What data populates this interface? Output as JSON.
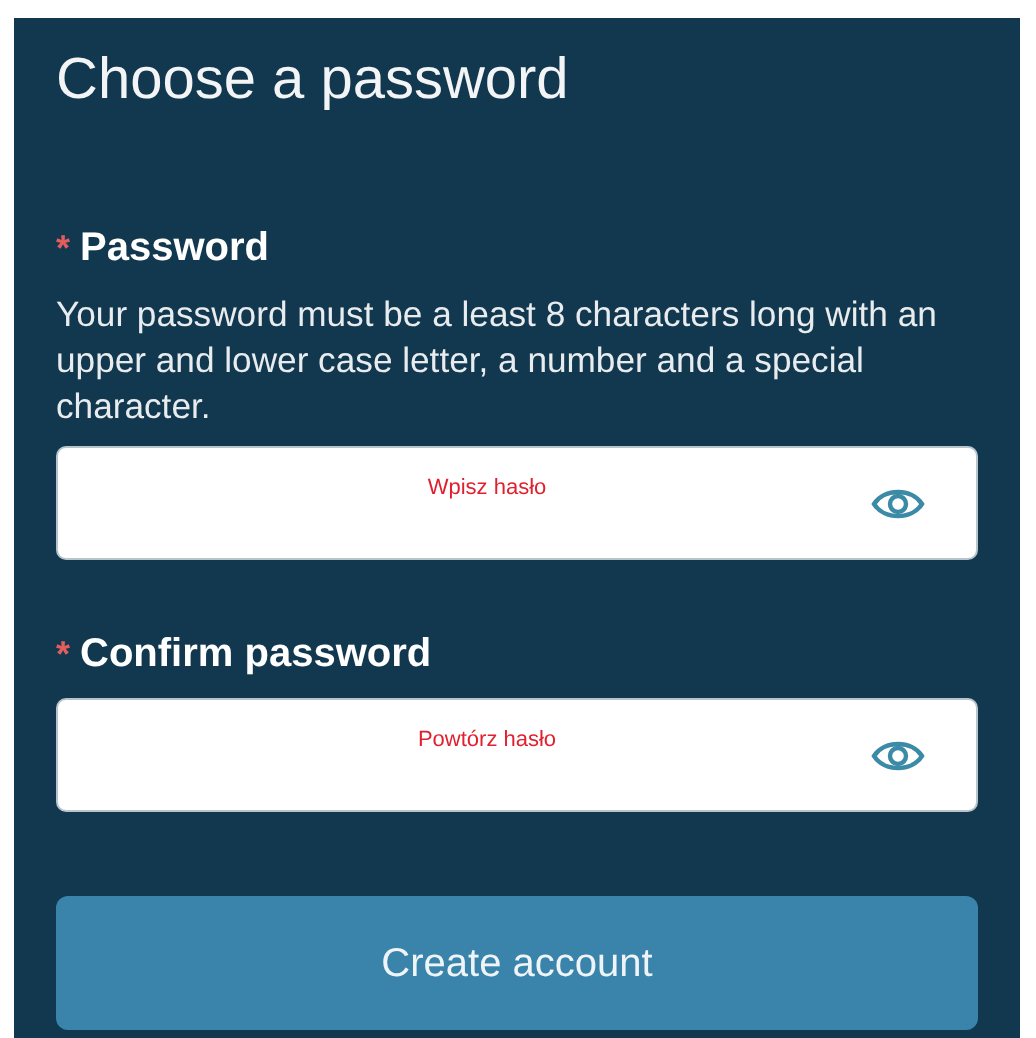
{
  "title": "Choose a password",
  "fields": [
    {
      "label": "Password",
      "required": true,
      "required_mark": "*",
      "description": "Your password must be a least 8 characters long with an upper and lower case letter, a number and a special character.",
      "placeholder": "Wpisz hasło"
    },
    {
      "label": "Confirm password",
      "required": true,
      "required_mark": "*",
      "placeholder": "Powtórz hasło"
    }
  ],
  "button": "Create account"
}
